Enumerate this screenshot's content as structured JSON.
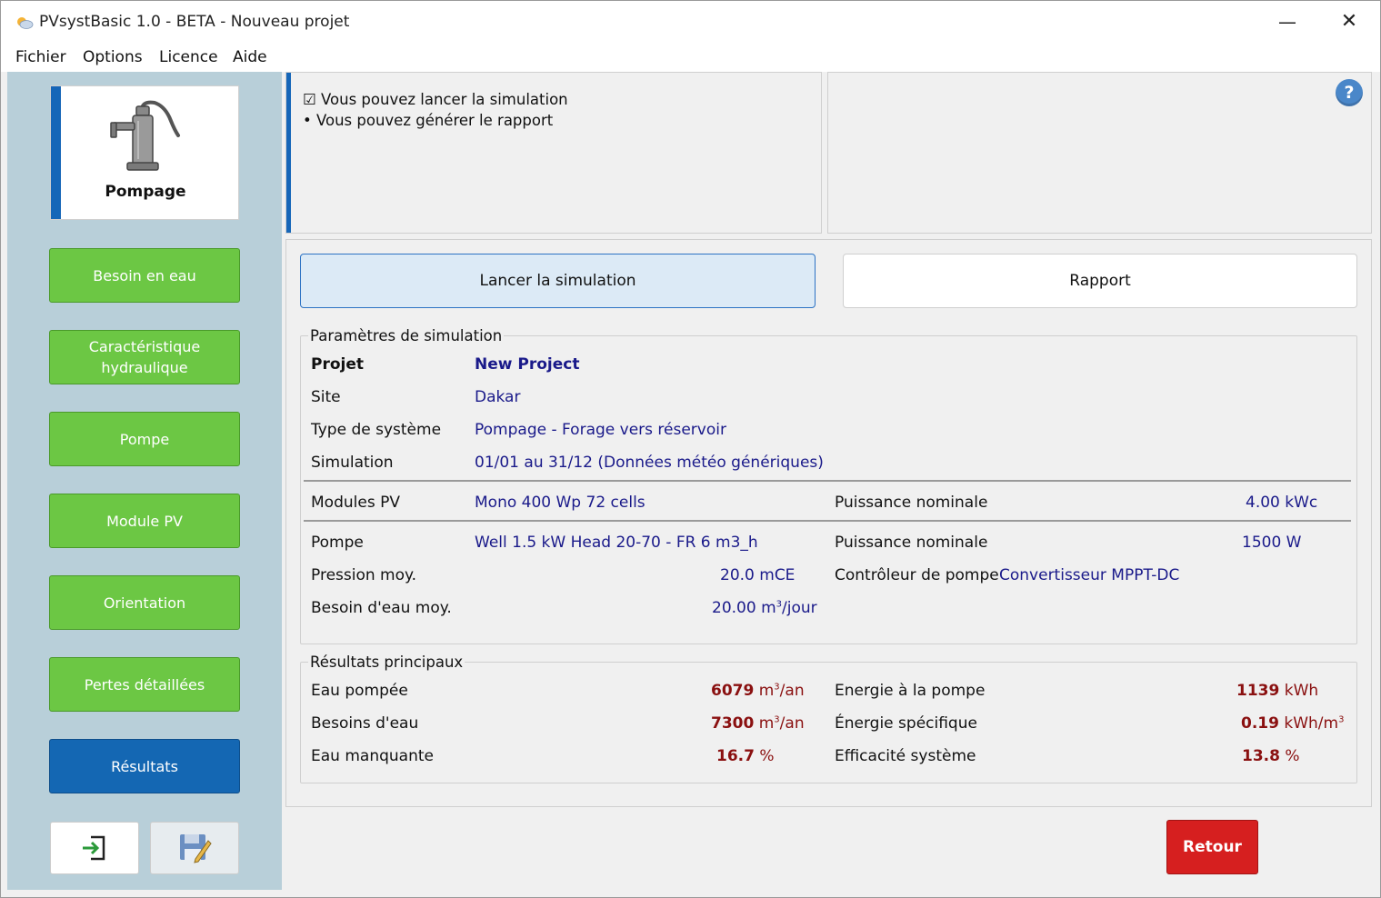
{
  "window": {
    "title": "PVsystBasic 1.0 - BETA - Nouveau projet",
    "minimize_symbol": "—",
    "close_symbol": "✕"
  },
  "menu": [
    "Fichier",
    "Options",
    "Licence",
    "Aide"
  ],
  "sidebar": {
    "mode_label": "Pompage",
    "buttons": [
      "Besoin en eau",
      "Caractéristique hydraulique",
      "Pompe",
      "Module PV",
      "Orientation",
      "Pertes détaillées",
      "Résultats"
    ],
    "active": "Résultats"
  },
  "info": {
    "line1": "☑ Vous pouvez lancer la simulation",
    "line2": "• Vous pouvez générer le rapport"
  },
  "help_icon": "?",
  "actions": {
    "simulate": "Lancer la simulation",
    "report": "Rapport"
  },
  "params": {
    "legend": "Paramètres de simulation",
    "projet_label": "Projet",
    "projet_value": "New Project",
    "site_label": "Site",
    "site_value": "Dakar",
    "type_label": "Type de système",
    "type_value": "Pompage - Forage vers réservoir",
    "sim_label": "Simulation",
    "sim_value": "01/01 au 31/12 (Données météo génériques)",
    "modules_label": "Modules PV",
    "modules_value": "Mono 400 Wp 72 cells",
    "modules_power_label": "Puissance nominale",
    "modules_power_value": "4.00 kWc",
    "pompe_label": "Pompe",
    "pompe_value": "Well 1.5 kW Head 20-70 - FR 6 m3_h",
    "pompe_power_label": "Puissance nominale",
    "pompe_power_value": "1500 W",
    "pression_label": "Pression moy.",
    "pression_value": "20.0 mCE",
    "controleur_label": "Contrôleur de pompe",
    "controleur_value": "Convertisseur MPPT-DC",
    "besoin_label": "Besoin d'eau moy.",
    "besoin_value": "20.00 m",
    "besoin_sup": "3",
    "besoin_unit": "/jour"
  },
  "results": {
    "legend": "Résultats principaux",
    "eau_pompee_label": "Eau pompée",
    "eau_pompee_value": "6079",
    "eau_pompee_unit": " m",
    "eau_pompee_sup": "3",
    "eau_pompee_unit2": "/an",
    "besoins_label": "Besoins d'eau",
    "besoins_value": "7300",
    "besoins_unit": " m",
    "besoins_sup": "3",
    "besoins_unit2": "/an",
    "manquante_label": "Eau manquante",
    "manquante_value": "16.7",
    "manquante_unit": " %",
    "energie_label": "Energie à la pompe",
    "energie_value": "1139",
    "energie_unit": " kWh",
    "specifique_label": "Énergie spécifique",
    "specifique_value": "0.19",
    "specifique_unit": " kWh/m",
    "specifique_sup": "3",
    "efficacite_label": "Efficacité système",
    "efficacite_value": "13.8",
    "efficacite_unit": " %"
  },
  "footer": {
    "retour": "Retour"
  },
  "colors": {
    "nav_green": "#6cc744",
    "nav_active": "#1467b3",
    "accent_blue": "#1666b8",
    "value_blue": "#1a1a8a",
    "result_red": "#8a1010",
    "retour_red": "#d61f1f"
  }
}
